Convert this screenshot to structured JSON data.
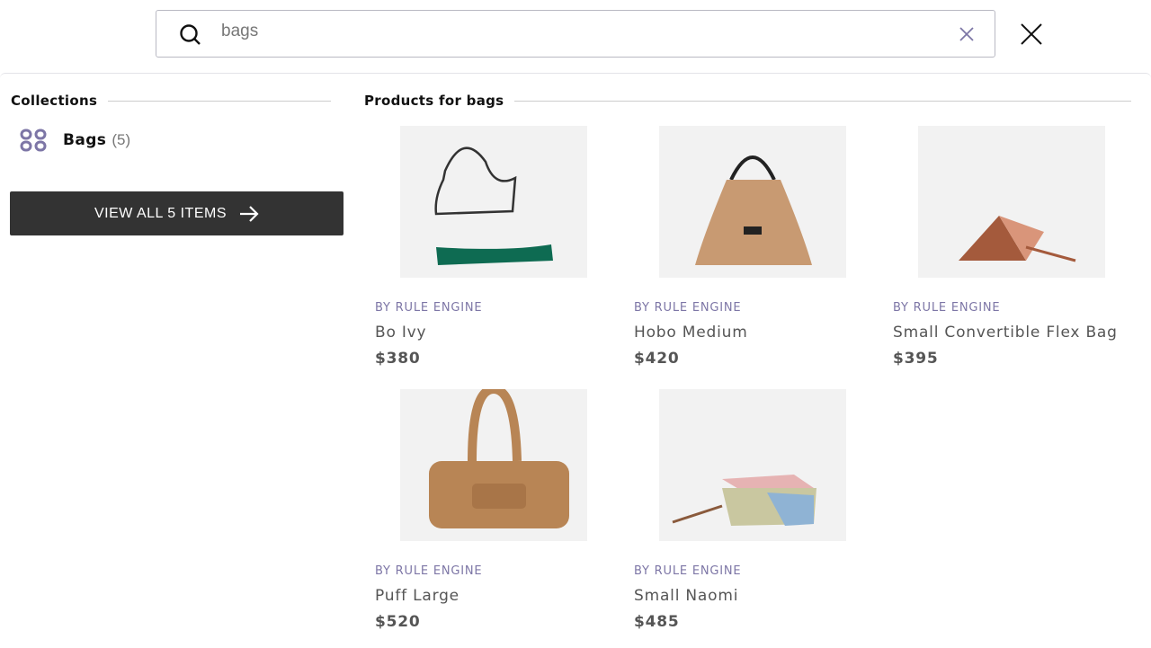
{
  "search": {
    "value": "bags",
    "icon": "search-icon",
    "clear_icon": "clear-icon",
    "close_icon": "close-icon"
  },
  "collections": {
    "heading": "Collections",
    "items": [
      {
        "name": "Bags",
        "count": "(5)",
        "icon": "grid-icon"
      }
    ],
    "view_all_label": "VIEW ALL 5 ITEMS"
  },
  "products": {
    "heading": "Products for bags",
    "items": [
      {
        "vendor": "BY RULE ENGINE",
        "title": "Bo Ivy",
        "price": "$380",
        "color": "#0e6b52"
      },
      {
        "vendor": "BY RULE ENGINE",
        "title": "Hobo Medium",
        "price": "$420",
        "color": "#c89a72"
      },
      {
        "vendor": "BY RULE ENGINE",
        "title": "Small Convertible Flex Bag",
        "price": "$395",
        "color": "#a45a3c"
      },
      {
        "vendor": "BY RULE ENGINE",
        "title": "Puff Large",
        "price": "$520",
        "color": "#b88555"
      },
      {
        "vendor": "BY RULE ENGINE",
        "title": "Small Naomi",
        "price": "$485",
        "color": "#e6b3b3"
      }
    ]
  },
  "colors": {
    "accent": "#7d76a6",
    "button": "#333333"
  }
}
